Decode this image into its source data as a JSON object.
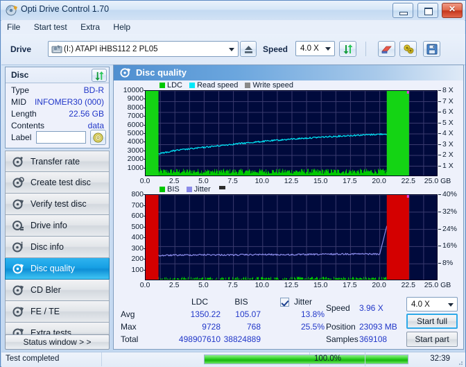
{
  "window": {
    "title": "Opti Drive Control 1.70",
    "icon": "disc-icon",
    "minimize_label": "",
    "maximize_label": "",
    "close_label": "✕"
  },
  "menu": {
    "items": [
      {
        "label": "File"
      },
      {
        "label": "Start test"
      },
      {
        "label": "Extra"
      },
      {
        "label": "Help"
      }
    ]
  },
  "toolbar": {
    "drive_label": "Drive",
    "drive_value": "(I:)  ATAPI iHBS112  2 PL05",
    "eject_icon": "eject-icon",
    "speed_label": "Speed",
    "speed_value": "4.0 X",
    "refresh_icon": "refresh-icon",
    "eraser_icon": "eraser-icon",
    "settings_icon": "gear-icon",
    "save_icon": "save-icon"
  },
  "disc_panel": {
    "title": "Disc",
    "refresh_icon": "refresh-icon",
    "rows": [
      {
        "key": "Type",
        "value": "BD-R"
      },
      {
        "key": "MID",
        "value": "INFOMER30 (000)"
      },
      {
        "key": "Length",
        "value": "22.56 GB"
      },
      {
        "key": "Contents",
        "value": "data"
      }
    ],
    "label_key": "Label",
    "label_value": "",
    "label_placeholder": "",
    "disc_icon": "cd-icon"
  },
  "sidebar": {
    "items": [
      {
        "label": "Transfer rate",
        "icon": "disc-speed-icon",
        "selected": false
      },
      {
        "label": "Create test disc",
        "icon": "disc-burn-icon",
        "selected": false
      },
      {
        "label": "Verify test disc",
        "icon": "disc-check-icon",
        "selected": false
      },
      {
        "label": "Drive info",
        "icon": "drive-info-icon",
        "selected": false
      },
      {
        "label": "Disc info",
        "icon": "disc-info-icon",
        "selected": false
      },
      {
        "label": "Disc quality",
        "icon": "disc-quality-icon",
        "selected": true
      },
      {
        "label": "CD Bler",
        "icon": "disc-bler-icon",
        "selected": false
      },
      {
        "label": "FE / TE",
        "icon": "disc-fete-icon",
        "selected": false
      },
      {
        "label": "Extra tests",
        "icon": "disc-extra-icon",
        "selected": false
      }
    ],
    "status_window_label": "Status window > >"
  },
  "main": {
    "title": "Disc quality",
    "icon": "disc-quality-icon"
  },
  "results": {
    "col_ldc": "LDC",
    "col_bis": "BIS",
    "jitter_label": "Jitter",
    "jitter_checked": true,
    "rows": [
      {
        "label": "Avg",
        "ldc": "1350.22",
        "bis": "105.07",
        "jitter": "13.8%"
      },
      {
        "label": "Max",
        "ldc": "9728",
        "bis": "768",
        "jitter": "25.5%"
      },
      {
        "label": "Total",
        "ldc": "498907610",
        "bis": "38824889",
        "jitter": ""
      }
    ],
    "speed_label": "Speed",
    "speed_value": "3.96 X",
    "position_label": "Position",
    "position_value": "23093 MB",
    "samples_label": "Samples",
    "samples_value": "369108",
    "speed_select": "4.0 X",
    "start_full_label": "Start full",
    "start_part_label": "Start part"
  },
  "statusbar": {
    "message": "Test completed",
    "percent_label": "100.0%",
    "percent_value": 100,
    "elapsed": "32:39"
  },
  "colors": {
    "ldc_green": "#00c800",
    "read_speed_cyan": "#00e8f8",
    "write_speed_gray": "#8a8a8a",
    "bis_green": "#00c800",
    "jitter_blue": "#8a8ae8",
    "plot_bg": "#000a3c",
    "bar_green": "#14d414",
    "bar_red": "#d40000",
    "accent_blue": "#2036c8"
  },
  "chart_data": [
    {
      "type": "line",
      "title": "LDC / Read speed",
      "xlabel": "GB",
      "ylabel": "LDC",
      "xlim": [
        0,
        25.0
      ],
      "ylim": [
        0,
        10000
      ],
      "y2lim": [
        0,
        8
      ],
      "y2label": "X",
      "grid": true,
      "legend_position": "top-left",
      "legend": [
        "LDC",
        "Read speed",
        "Write speed"
      ],
      "xticks": [
        "0.0",
        "2.5",
        "5.0",
        "7.5",
        "10.0",
        "12.5",
        "15.0",
        "17.5",
        "20.0",
        "22.5",
        "25.0 GB"
      ],
      "yticks": [
        "1000",
        "2000",
        "3000",
        "4000",
        "5000",
        "6000",
        "7000",
        "8000",
        "9000",
        "10000"
      ],
      "y2ticks": [
        "1 X",
        "2 X",
        "3 X",
        "4 X",
        "5 X",
        "6 X",
        "7 X",
        "8 X"
      ],
      "series": [
        {
          "name": "Read speed",
          "color": "#00e8f8",
          "x": [
            1.1,
            2.5,
            5.0,
            7.5,
            10.0,
            12.5,
            15.0,
            17.5,
            20.0,
            21.5,
            22.4
          ],
          "values": [
            2.15,
            2.45,
            2.75,
            3.05,
            3.3,
            3.52,
            3.7,
            3.85,
            3.97,
            4.05,
            4.02
          ]
        },
        {
          "name": "LDC",
          "color": "#00c800",
          "note": "noise band averaging approximately 350 with peaks near 900",
          "avg": 350,
          "peak": 950
        }
      ],
      "highlight_bands": [
        {
          "from": 0.0,
          "to": 1.1,
          "color": "#14d414",
          "note": "lead-in no-data region"
        },
        {
          "from": 20.6,
          "to": 22.5,
          "color": "#14d414",
          "note": "unrecorded tail region"
        }
      ]
    },
    {
      "type": "line",
      "title": "BIS / Jitter",
      "xlabel": "GB",
      "ylabel": "BIS",
      "xlim": [
        0,
        25.0
      ],
      "ylim": [
        0,
        800
      ],
      "y2lim": [
        0,
        40
      ],
      "y2label": "%",
      "grid": true,
      "legend_position": "top-left",
      "legend": [
        "BIS",
        "Jitter"
      ],
      "xticks": [
        "0.0",
        "2.5",
        "5.0",
        "7.5",
        "10.0",
        "12.5",
        "15.0",
        "17.5",
        "20.0",
        "22.5",
        "25.0 GB"
      ],
      "yticks": [
        "100",
        "200",
        "300",
        "400",
        "500",
        "600",
        "700",
        "800"
      ],
      "y2ticks": [
        "8%",
        "16%",
        "24%",
        "32%",
        "40%"
      ],
      "series": [
        {
          "name": "Jitter",
          "color": "#8a8ae8",
          "x": [
            1.1,
            2.5,
            5.0,
            7.5,
            10.0,
            12.5,
            15.0,
            17.5,
            20.0,
            20.6,
            22.4
          ],
          "values": [
            11.8,
            12.0,
            12.2,
            12.1,
            12.3,
            12.2,
            12.4,
            12.6,
            12.5,
            25.5,
            25.5
          ]
        },
        {
          "name": "BIS",
          "color": "#00c800",
          "note": "near-zero baseline with sparse small spikes",
          "avg": 6,
          "peak": 40
        }
      ],
      "highlight_bands": [
        {
          "from": 0.0,
          "to": 1.1,
          "color": "#d40000",
          "note": "lead-in no-data region"
        },
        {
          "from": 20.6,
          "to": 22.5,
          "color": "#d40000",
          "note": "unrecorded tail region"
        }
      ]
    }
  ]
}
